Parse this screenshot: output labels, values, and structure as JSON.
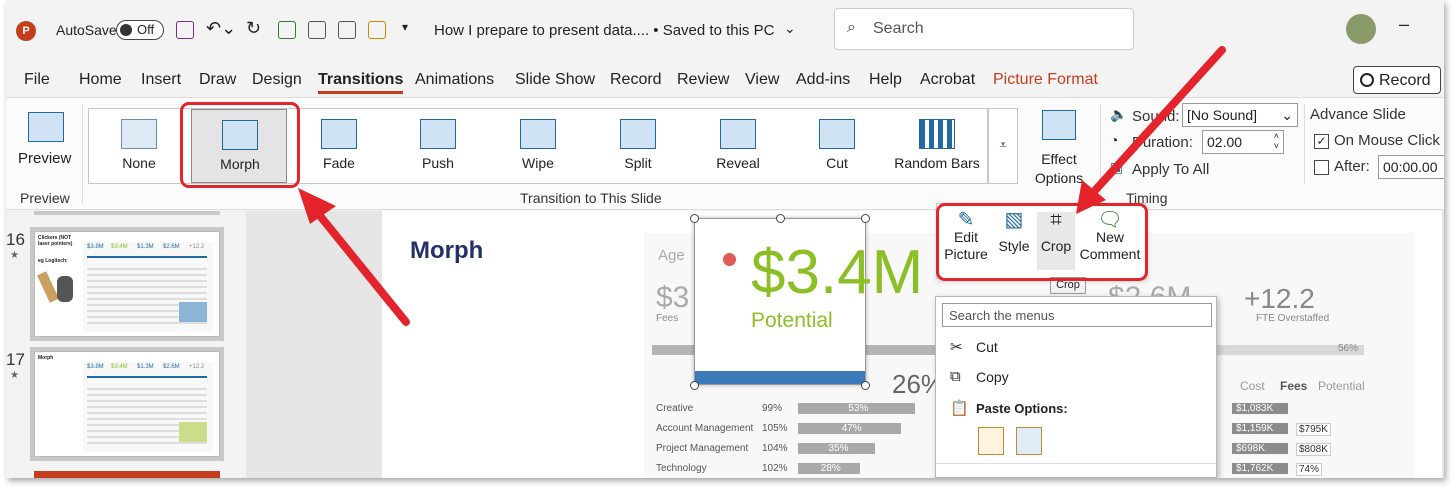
{
  "titlebar": {
    "autosave_label": "AutoSave",
    "autosave_state": "Off",
    "document_title": "How I prepare to present data.... • Saved to this PC",
    "search_placeholder": "Search"
  },
  "tabs": [
    "File",
    "Home",
    "Insert",
    "Draw",
    "Design",
    "Transitions",
    "Animations",
    "Slide Show",
    "Record",
    "Review",
    "View",
    "Add-ins",
    "Help",
    "Acrobat",
    "Picture Format"
  ],
  "active_tab": "Transitions",
  "record_button": "Record",
  "ribbon": {
    "preview_label": "Preview",
    "preview_group": "Preview",
    "transitions": [
      "None",
      "Morph",
      "Fade",
      "Push",
      "Wipe",
      "Split",
      "Reveal",
      "Cut",
      "Random Bars"
    ],
    "effect_options": "Effect Options",
    "group_label": "Transition to This Slide",
    "sound_label": "Sound:",
    "sound_value": "[No Sound]",
    "duration_label": "Duration:",
    "duration_value": "02.00",
    "apply_all": "Apply To All",
    "advance_title": "Advance Slide",
    "on_mouse_click": "On Mouse Click",
    "after_label": "After:",
    "after_value": "00:00.00",
    "timing_group": "Timing"
  },
  "thumbnails": {
    "slide16": "16",
    "slide17": "17",
    "slide16_title": "Clickers (NOT laser pointers)",
    "slide16_sub": "eg Logitech:",
    "slide17_title": "Morph",
    "thumb_kpis": [
      "$3.8M",
      "$3.4M",
      "$1.3M",
      "$2.6M",
      "+12.2"
    ]
  },
  "slide": {
    "title": "Morph",
    "big_value": "$3.4M",
    "big_label": "Potential",
    "bg_label": "Age",
    "bg_kpi_left": "$3",
    "bg_fees": "Fees",
    "bg_kpi_2": "$2.6M",
    "bg_kpi_3": "+12.2",
    "bg_fte": "FTE Overstaffed",
    "bg_pct": "56%",
    "legend": [
      "Cost",
      "Fees",
      "Potential"
    ],
    "bg_partial_value": "26%",
    "rows": [
      {
        "name": "Creative",
        "pct": "99%",
        "bar": "53%",
        "cost": "$1,083K",
        "extra": ""
      },
      {
        "name": "Account Management",
        "pct": "105%",
        "bar": "47%",
        "cost": "$1,159K",
        "extra": "$795K"
      },
      {
        "name": "Project Management",
        "pct": "104%",
        "bar": "35%",
        "cost": "$698K",
        "extra": "$808K"
      },
      {
        "name": "Technology",
        "pct": "102%",
        "bar": "28%",
        "cost": "$1,762K",
        "extra": "74%"
      }
    ]
  },
  "mini_toolbar": {
    "buttons": [
      "Edit Picture",
      "Style",
      "Crop",
      "New Comment"
    ],
    "tooltip": "Crop"
  },
  "context_menu": {
    "search_placeholder": "Search the menus",
    "cut": "Cut",
    "copy": "Copy",
    "paste_options": "Paste Options:"
  },
  "colors": {
    "accent": "#c43e1c",
    "highlight": "#e3242b",
    "kpi_green": "#8cbf26",
    "title_blue": "#24306b"
  }
}
